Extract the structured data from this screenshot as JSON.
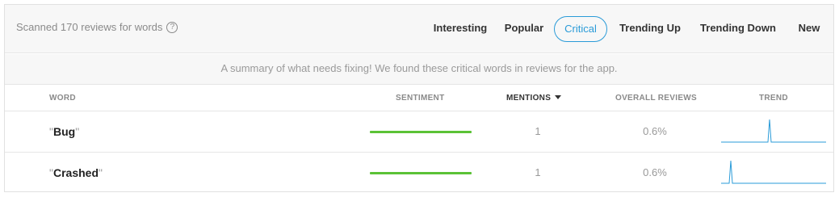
{
  "header": {
    "scan_text": "Scanned 170 reviews for words",
    "help_icon": "question-circle-icon",
    "tabs": [
      {
        "label": "Interesting",
        "active": false
      },
      {
        "label": "Popular",
        "active": false
      },
      {
        "label": "Critical",
        "active": true
      },
      {
        "label": "Trending Up",
        "active": false
      },
      {
        "label": "Trending Down",
        "active": false
      },
      {
        "label": "New",
        "active": false
      }
    ]
  },
  "summary": "A summary of what needs fixing! We found these critical words in reviews for the app.",
  "columns": {
    "word": "WORD",
    "sentiment": "SENTIMENT",
    "mentions": "MENTIONS",
    "overall": "OVERALL REVIEWS",
    "trend": "TREND"
  },
  "sort_icon": "caret-down-icon",
  "rows": [
    {
      "word": "Bug",
      "sentiment": 1.0,
      "mentions": "1",
      "overall": "0.6%",
      "trend_peak": 0.46
    },
    {
      "word": "Crashed",
      "sentiment": 1.0,
      "mentions": "1",
      "overall": "0.6%",
      "trend_peak": 0.09
    }
  ],
  "colors": {
    "accent": "#2a9bd8",
    "sentiment_positive": "#5bc236",
    "trend_line": "#2a9bd8"
  }
}
